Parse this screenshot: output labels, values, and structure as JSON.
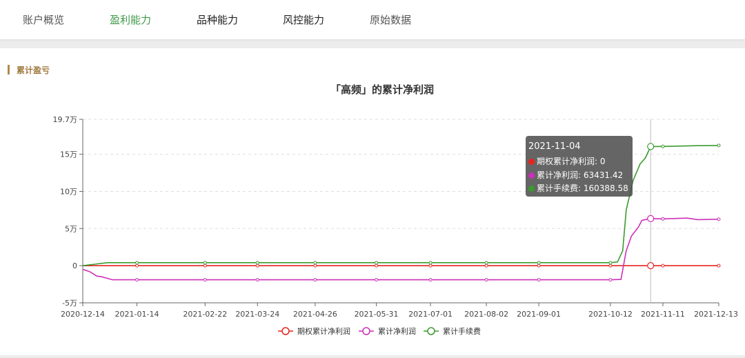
{
  "tabs": [
    {
      "label": "账户概览",
      "state": "normal"
    },
    {
      "label": "盈利能力",
      "state": "active"
    },
    {
      "label": "品种能力",
      "state": "dark"
    },
    {
      "label": "风控能力",
      "state": "dark"
    },
    {
      "label": "原始数据",
      "state": "normal"
    }
  ],
  "section": {
    "title": "累计盈亏"
  },
  "colors": {
    "accent": "#3f9a48",
    "section": "#b08a4a"
  },
  "tooltip": {
    "date": "2021-11-04",
    "rows": [
      {
        "label": "期权累计净利润: 0",
        "color": "#e8231f"
      },
      {
        "label": "累计净利润: 63431.42",
        "color": "#cc2fb8"
      },
      {
        "label": "累计手续费: 160388.58",
        "color": "#3a9a2e"
      }
    ]
  },
  "chart_data": {
    "type": "line",
    "title": "「高频」的累计净利润",
    "xlabel": "",
    "ylabel": "",
    "x_ticks": [
      "2020-12-14",
      "2021-01-14",
      "2021-02-22",
      "2021-03-24",
      "2021-04-26",
      "2021-05-31",
      "2021-07-01",
      "2021-08-02",
      "2021-09-01",
      "2021-10-12",
      "2021-11-11",
      "2021-12-13"
    ],
    "y_ticks": [
      {
        "value": -50000,
        "label": "-5万"
      },
      {
        "value": 0,
        "label": "0"
      },
      {
        "value": 50000,
        "label": "5万"
      },
      {
        "value": 100000,
        "label": "10万"
      },
      {
        "value": 150000,
        "label": "15万"
      },
      {
        "value": 197000,
        "label": "19.7万"
      }
    ],
    "ylim": [
      -50000,
      197000
    ],
    "grid": true,
    "legend": "bottom-center",
    "highlight_x": "2021-11-04",
    "series": [
      {
        "name": "期权累计净利润",
        "color": "#e8231f",
        "points": [
          [
            "2020-12-14",
            0
          ],
          [
            "2021-01-14",
            0
          ],
          [
            "2021-02-22",
            0
          ],
          [
            "2021-03-24",
            0
          ],
          [
            "2021-04-26",
            0
          ],
          [
            "2021-05-31",
            0
          ],
          [
            "2021-07-01",
            0
          ],
          [
            "2021-08-02",
            0
          ],
          [
            "2021-09-01",
            0
          ],
          [
            "2021-10-12",
            0
          ],
          [
            "2021-11-04",
            0
          ],
          [
            "2021-11-11",
            0
          ],
          [
            "2021-12-13",
            0
          ]
        ]
      },
      {
        "name": "累计净利润",
        "color": "#cc2fb8",
        "points": [
          [
            "2020-12-14",
            -5000
          ],
          [
            "2020-12-18",
            -8000
          ],
          [
            "2020-12-22",
            -14000
          ],
          [
            "2020-12-25",
            -15000
          ],
          [
            "2020-12-28",
            -17000
          ],
          [
            "2020-12-31",
            -19000
          ],
          [
            "2021-01-14",
            -19000
          ],
          [
            "2021-02-22",
            -19000
          ],
          [
            "2021-03-24",
            -19000
          ],
          [
            "2021-04-26",
            -19000
          ],
          [
            "2021-05-31",
            -19000
          ],
          [
            "2021-07-01",
            -19000
          ],
          [
            "2021-08-02",
            -19000
          ],
          [
            "2021-09-01",
            -19000
          ],
          [
            "2021-10-12",
            -19000
          ],
          [
            "2021-10-18",
            -18500
          ],
          [
            "2021-10-21",
            20000
          ],
          [
            "2021-10-24",
            40000
          ],
          [
            "2021-10-28",
            52000
          ],
          [
            "2021-10-30",
            61000
          ],
          [
            "2021-11-04",
            63431.42
          ],
          [
            "2021-11-11",
            63000
          ],
          [
            "2021-11-25",
            64000
          ],
          [
            "2021-12-01",
            62000
          ],
          [
            "2021-12-13",
            62500
          ]
        ]
      },
      {
        "name": "累计手续费",
        "color": "#3a9a2e",
        "points": [
          [
            "2020-12-14",
            0
          ],
          [
            "2020-12-21",
            2000
          ],
          [
            "2020-12-28",
            4000
          ],
          [
            "2021-01-14",
            4000
          ],
          [
            "2021-02-22",
            4000
          ],
          [
            "2021-03-24",
            4000
          ],
          [
            "2021-04-26",
            4000
          ],
          [
            "2021-05-31",
            4000
          ],
          [
            "2021-07-01",
            4000
          ],
          [
            "2021-08-02",
            4000
          ],
          [
            "2021-09-01",
            4000
          ],
          [
            "2021-10-12",
            4000
          ],
          [
            "2021-10-16",
            5000
          ],
          [
            "2021-10-19",
            20000
          ],
          [
            "2021-10-21",
            75000
          ],
          [
            "2021-10-25",
            115000
          ],
          [
            "2021-10-29",
            137000
          ],
          [
            "2021-11-01",
            145000
          ],
          [
            "2021-11-04",
            160388.58
          ],
          [
            "2021-11-11",
            160500
          ],
          [
            "2021-12-01",
            161500
          ],
          [
            "2021-12-13",
            161800
          ]
        ]
      }
    ]
  }
}
